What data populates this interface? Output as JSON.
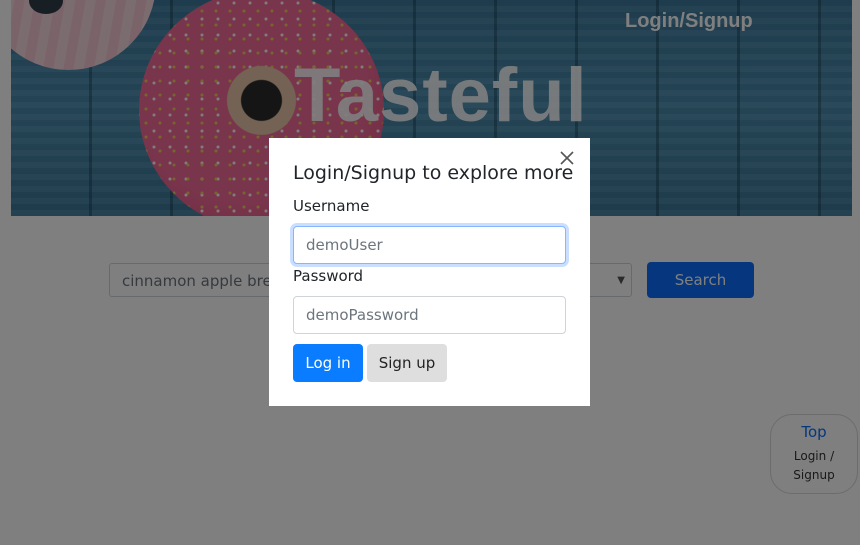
{
  "hero": {
    "title": "Tasteful",
    "login_link": "Login/Signup"
  },
  "search": {
    "value": "cinnamon apple brea",
    "select_value": "p",
    "button_label": "Search"
  },
  "float_widget": {
    "top_label": "Top",
    "login_label": "Login / Signup"
  },
  "modal": {
    "title": "Login/Signup to explore more",
    "close_icon": "close-icon",
    "username_label": "Username",
    "username_placeholder": "demoUser",
    "password_label": "Password",
    "password_placeholder": "demoPassword",
    "login_button": "Log in",
    "signup_button": "Sign up"
  },
  "colors": {
    "primary": "#0a7cff",
    "secondary_button": "#dedede",
    "overlay": "rgba(0,0,0,0.5)"
  }
}
